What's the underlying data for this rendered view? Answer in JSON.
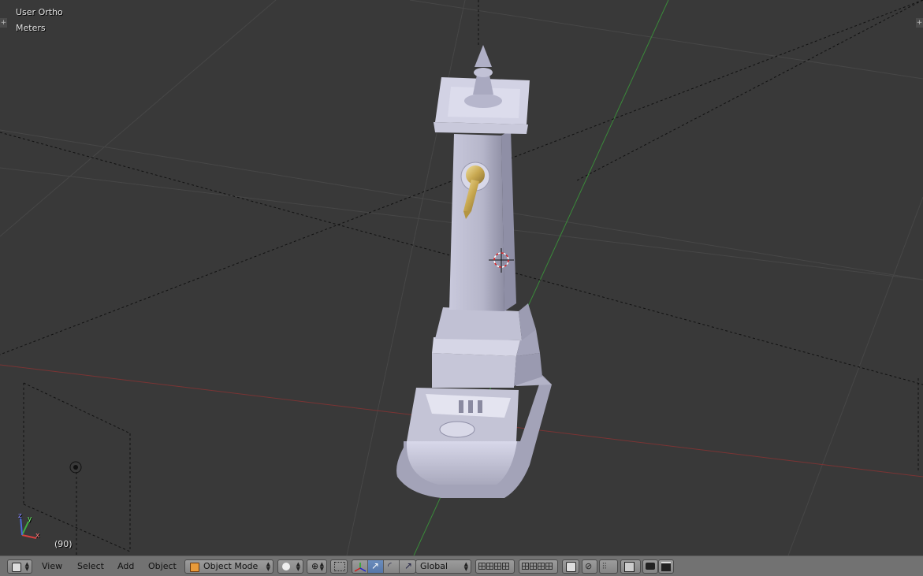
{
  "viewport": {
    "view_name": "User Ortho",
    "units": "Meters",
    "frame": "(90)",
    "axes": {
      "x": "x",
      "y": "y",
      "z": "z"
    }
  },
  "header": {
    "menus": [
      "View",
      "Select",
      "Add",
      "Object"
    ],
    "mode": "Object Mode",
    "orientation": "Global"
  },
  "colors": {
    "background": "#393939",
    "grid": "#4a4a4a",
    "x_axis": "#8a3a3a",
    "y_axis": "#3c8c3c",
    "footer": "#727272",
    "active_button": "#5a7cb0"
  }
}
